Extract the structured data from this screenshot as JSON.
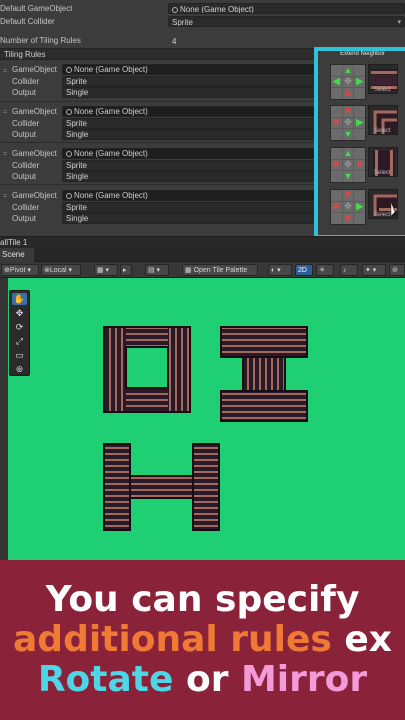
{
  "inspector": {
    "default_gameobject_label": "Default GameObject",
    "default_gameobject_value": "None (Game Object)",
    "default_collider_label": "Default Collider",
    "default_collider_value": "Sprite",
    "num_rules_label": "Number of Tiling Rules",
    "num_rules_value": "4",
    "tiling_rules_header": "Tiling Rules",
    "extend_neighbor_label": "Extend Neighbor",
    "select_label": "Select",
    "rules": [
      {
        "gameobject_label": "GameObject",
        "gameobject_value": "None (Game Object)",
        "collider_label": "Collider",
        "collider_value": "Sprite",
        "output_label": "Output",
        "output_value": "Single"
      },
      {
        "gameobject_label": "GameObject",
        "gameobject_value": "None (Game Object)",
        "collider_label": "Collider",
        "collider_value": "Sprite",
        "output_label": "Output",
        "output_value": "Single"
      },
      {
        "gameobject_label": "GameObject",
        "gameobject_value": "None (Game Object)",
        "collider_label": "Collider",
        "collider_value": "Sprite",
        "output_label": "Output",
        "output_value": "Single"
      },
      {
        "gameobject_label": "GameObject",
        "gameobject_value": "None (Game Object)",
        "collider_label": "Collider",
        "collider_value": "Sprite",
        "output_label": "Output",
        "output_value": "Single"
      }
    ]
  },
  "asset_bar": {
    "label": "allTile 1"
  },
  "scene": {
    "tab_label": "Scene",
    "toolbar": {
      "pivot": "Pivot",
      "local": "Local",
      "open_tile_palette": "Open Tile Palette",
      "mode_2d": "2D"
    }
  },
  "banner": {
    "line1": "You can specify",
    "line2_a": "additional rules",
    "line2_b": " ex",
    "line3_a": "Rotate",
    "line3_b": " or ",
    "line3_c": "Mirror"
  },
  "colors": {
    "highlight": "#2ec3d7",
    "scene_bg": "#1fcf74",
    "banner_bg": "#8a2239",
    "banner_orange": "#f07a35",
    "banner_cyan": "#4fd6e6",
    "banner_pink": "#f39ad8",
    "banner_white": "#ffffff"
  }
}
